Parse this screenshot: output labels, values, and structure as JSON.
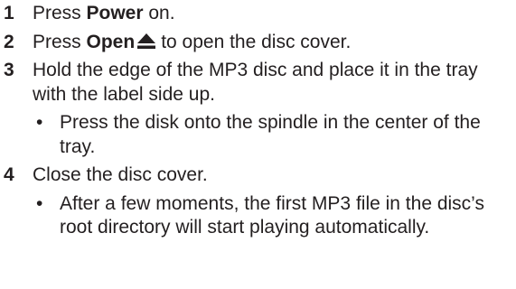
{
  "steps": [
    {
      "number": "1",
      "pre": "Press ",
      "bold": "Power",
      "post": " on."
    },
    {
      "number": "2",
      "pre": "Press ",
      "bold": "Open",
      "icon": "eject-icon",
      "post": "to open the disc cover."
    },
    {
      "number": "3",
      "text": "Hold the edge of the MP3 disc and place it in the tray with the label side up.",
      "bullet": "Press the disk onto the spindle in the center of the tray."
    },
    {
      "number": "4",
      "text": "Close the disc cover.",
      "bullet": "After a few moments, the first MP3 file in the disc’s root directory will start playing automatically."
    }
  ],
  "bullet_symbol": "•"
}
